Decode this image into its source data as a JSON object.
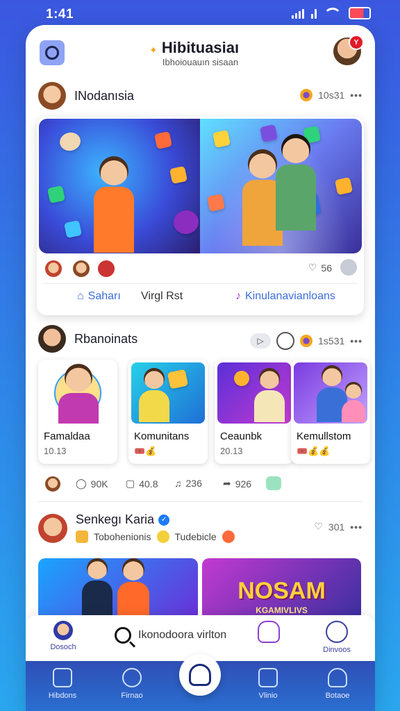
{
  "status": {
    "time": "1:41"
  },
  "header": {
    "title": "Hibituasiaı",
    "subtitle": "Ibhoiouauın sisaan",
    "avatar_badge": "Y"
  },
  "post1": {
    "author": "INodanısia",
    "meta_count": "10s31",
    "likes": "56",
    "actions": [
      {
        "label": "Saharı"
      },
      {
        "label": "Virgl Rst"
      },
      {
        "label": "Kinulanavianloans"
      }
    ]
  },
  "section2": {
    "title": "Rbanoinats",
    "meta_count": "1s531",
    "pill_label": "▷",
    "communities": [
      {
        "name": "Famaldaa",
        "count": "10.13"
      },
      {
        "name": "Komunitans",
        "count": "🎟️💰"
      },
      {
        "name": "Ceaunbk",
        "count": "20.13"
      },
      {
        "name": "Kemullstom",
        "count": "🎟️💰💰"
      }
    ],
    "stats": [
      {
        "value": "90K"
      },
      {
        "value": "40.8"
      },
      {
        "value": "236"
      },
      {
        "value": "926"
      }
    ]
  },
  "post3": {
    "author": "Senkegı Karia",
    "tag1": "Tobohenionis",
    "tag2": "Tudebicle",
    "count": "301",
    "banner_text": "NOSAM",
    "banner_sub": "KGAMIVLIVS"
  },
  "searchbar": {
    "left_label": "Dosoch",
    "placeholder": "Ikonodoora virlton",
    "right_label": "Dinvoos"
  },
  "tabs": [
    {
      "label": "Hibdons"
    },
    {
      "label": "Firnao"
    },
    {
      "label": "Vlinio"
    },
    {
      "label": "Botaoe"
    }
  ]
}
